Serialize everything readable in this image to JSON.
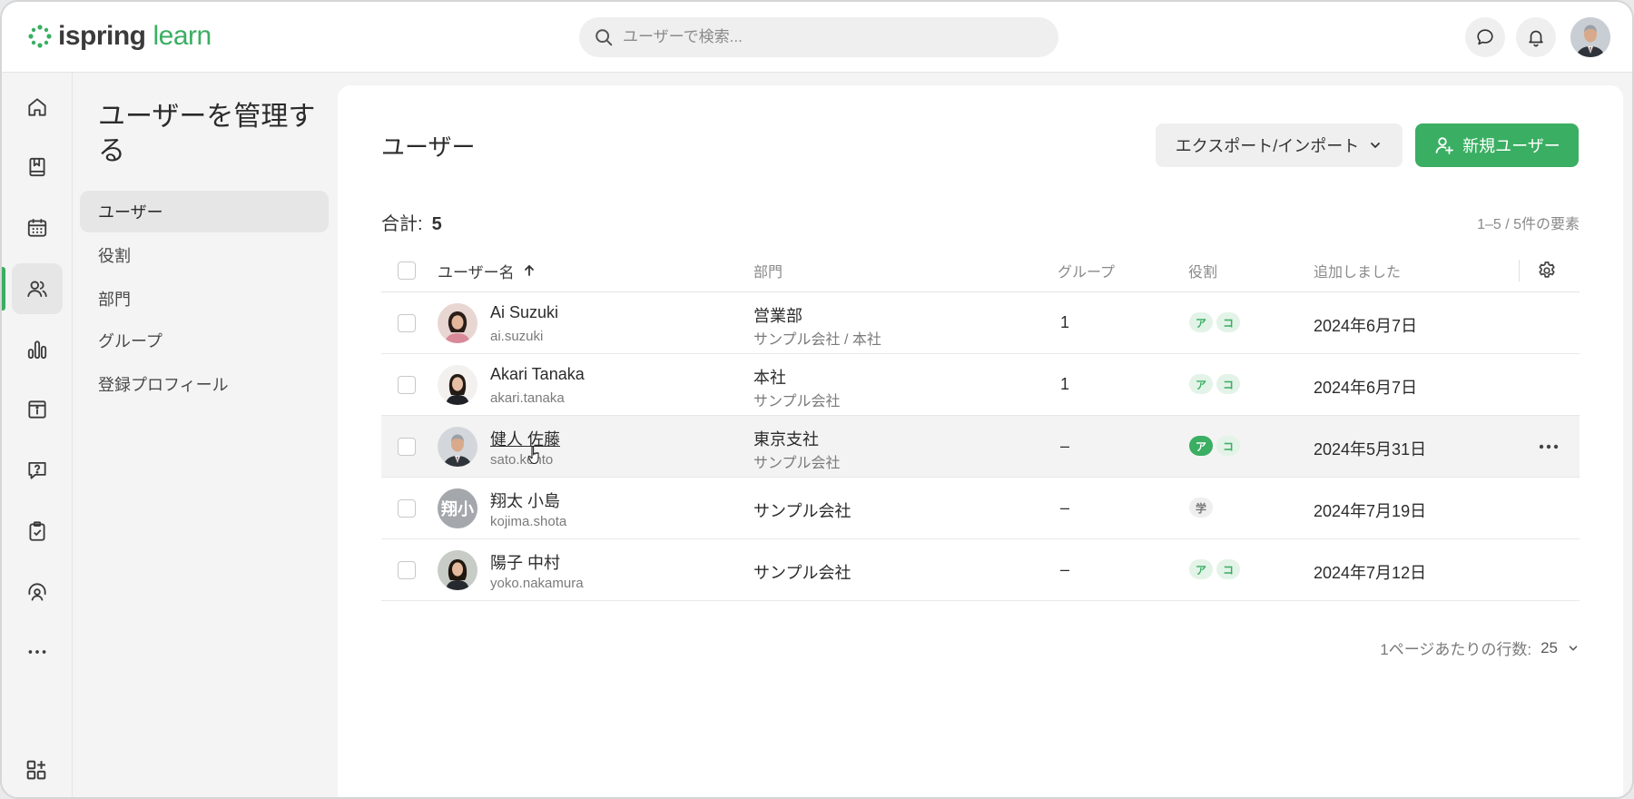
{
  "brand": {
    "name_part1": "ispring",
    "name_part2": "learn",
    "accent": "#3aae62"
  },
  "search": {
    "placeholder": "ユーザーで検索..."
  },
  "sidebar": {
    "title": "ユーザーを管理する",
    "items": [
      {
        "label": "ユーザー",
        "active": true
      },
      {
        "label": "役割"
      },
      {
        "label": "部門"
      },
      {
        "label": "グループ"
      },
      {
        "label": "登録プロフィール"
      }
    ]
  },
  "rail": {
    "icons": [
      "home-icon",
      "book-icon",
      "calendar-icon",
      "users-icon",
      "chart-icon",
      "info-archive-icon",
      "question-icon",
      "clipboard-check-icon",
      "support-icon",
      "more-dots-icon",
      "add-widget-icon"
    ]
  },
  "main": {
    "title": "ユーザー",
    "export_label": "エクスポート/インポート",
    "new_user_label": "新規ユーザー",
    "total_label": "合計:",
    "total_count": "5",
    "range_text": "1–5 / 5件の要素",
    "per_page_label": "1ページあたりの行数:",
    "per_page_value": "25"
  },
  "table": {
    "columns": [
      "ユーザー名",
      "部門",
      "グループ",
      "役割",
      "追加しました"
    ],
    "rows": [
      {
        "name": "Ai Suzuki",
        "login": "ai.suzuki",
        "dept": "営業部",
        "dept_path": "サンプル会社 / 本社",
        "groups": "1",
        "roles": [
          "ア",
          "コ"
        ],
        "added": "2024年6月7日"
      },
      {
        "name": "Akari Tanaka",
        "login": "akari.tanaka",
        "dept": "本社",
        "dept_path": "サンプル会社",
        "groups": "1",
        "roles": [
          "ア",
          "コ"
        ],
        "added": "2024年6月7日"
      },
      {
        "name": "健人 佐藤",
        "login": "sato.kento",
        "dept": "東京支社",
        "dept_path": "サンプル会社",
        "groups": "–",
        "roles": [
          "ア",
          "コ"
        ],
        "added": "2024年5月31日"
      },
      {
        "name": "翔太 小島",
        "login": "kojima.shota",
        "initials": "翔小",
        "dept": "サンプル会社",
        "groups": "–",
        "roles": [
          "学"
        ],
        "added": "2024年7月19日"
      },
      {
        "name": "陽子 中村",
        "login": "yoko.nakamura",
        "dept": "サンプル会社",
        "groups": "–",
        "roles": [
          "ア",
          "コ"
        ],
        "added": "2024年7月12日"
      }
    ]
  }
}
